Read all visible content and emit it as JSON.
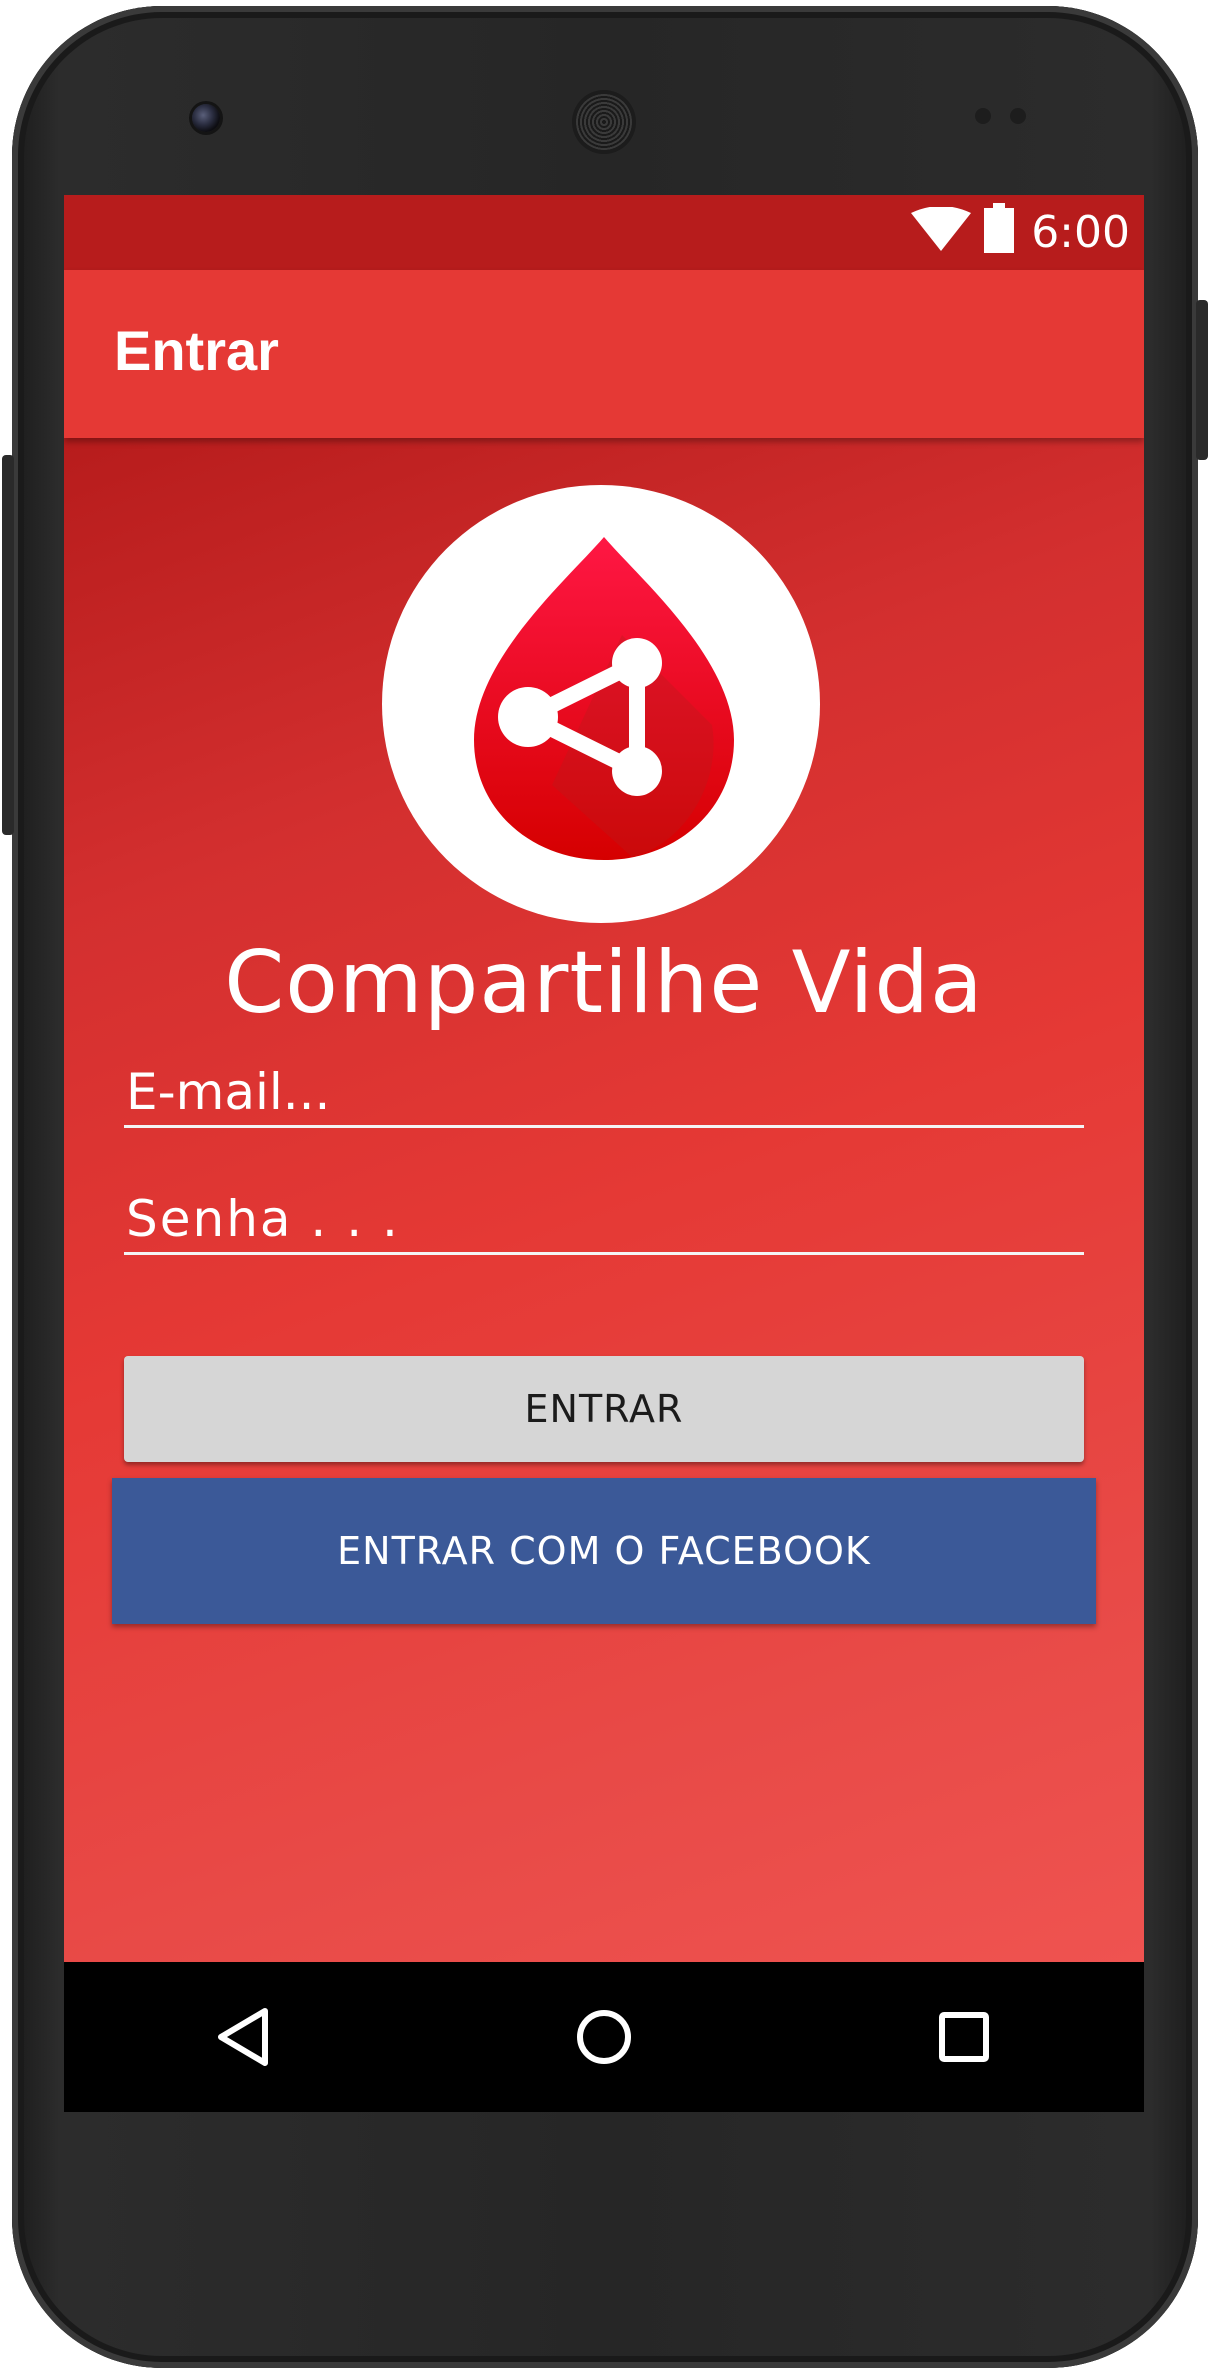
{
  "status_bar": {
    "time": "6:00",
    "icons": [
      "wifi-icon",
      "battery-icon"
    ]
  },
  "app_bar": {
    "title": "Entrar"
  },
  "branding": {
    "logo_icon": "blood-drop-share-icon",
    "app_name": "Compartilhe Vida"
  },
  "form": {
    "email_placeholder": "E-mail...",
    "password_placeholder": "Senha . . .",
    "login_button_label": "ENTRAR",
    "facebook_button_label": "ENTRAR COM O FACEBOOK"
  },
  "navigation_bar": {
    "icons": [
      "back-icon",
      "home-icon",
      "recents-icon"
    ]
  },
  "colors": {
    "primary": "#e53935",
    "primary_dark": "#b71c1c",
    "facebook_blue": "#3b5998",
    "button_gray": "#d6d6d6"
  }
}
